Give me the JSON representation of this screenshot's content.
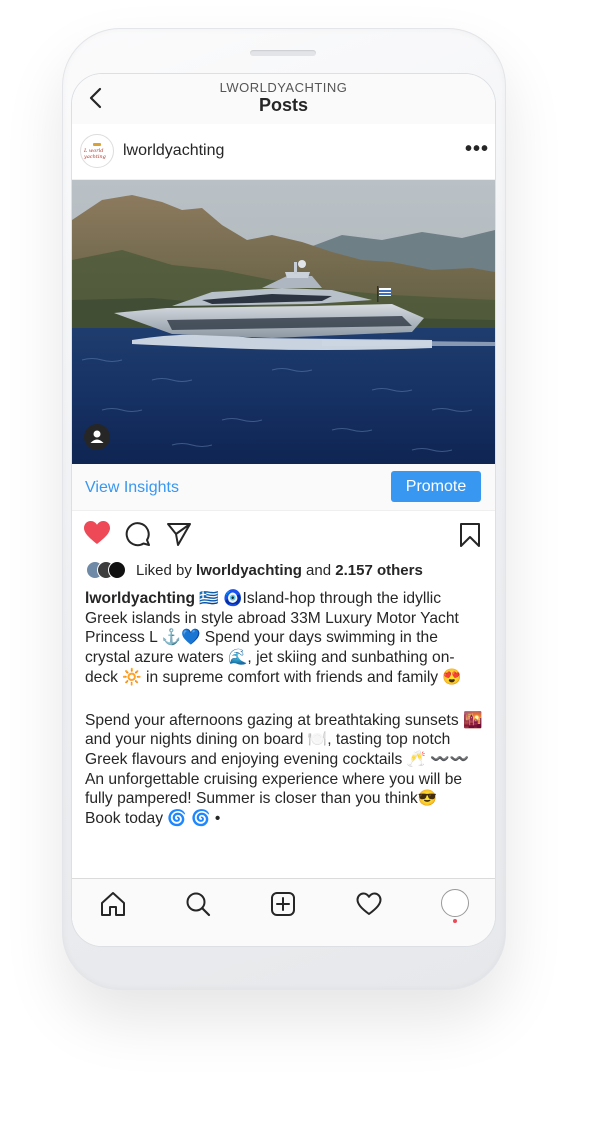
{
  "header": {
    "account": "LWORLDYACHTING",
    "title": "Posts"
  },
  "post": {
    "username": "lworldyachting",
    "avatar_text": "L world yachting",
    "insights_label": "View Insights",
    "promote_label": "Promote",
    "liked": {
      "prefix": "Liked by ",
      "user": "lworldyachting",
      "middle": " and ",
      "others": "2.157 others"
    },
    "caption": {
      "user": "lworldyachting",
      "line1": " 🇬🇷 🧿Island-hop through the idyllic Greek islands in style abroad 33M Luxury Motor Yacht Princess L ⚓💙 Spend your days swimming in the crystal azure waters 🌊, jet skiing and sunbathing on-deck 🔆 in supreme comfort with friends and family 😍",
      "line2": "Spend your afternoons gazing at breathtaking sunsets 🌇and your nights dining on board 🍽️, tasting top notch Greek flavours and enjoying evening cocktails 🥂 〰️〰️An unforgettable cruising experience where you will be fully pampered! Summer is closer than you think😎",
      "line3": "Book today 🌀 🌀 •"
    }
  },
  "nav": {
    "items": [
      "home-icon",
      "search-icon",
      "add-post-icon",
      "activity-icon",
      "profile-avatar"
    ]
  },
  "colors": {
    "accent": "#3897f0",
    "like": "#ed4956",
    "text": "#262626"
  }
}
